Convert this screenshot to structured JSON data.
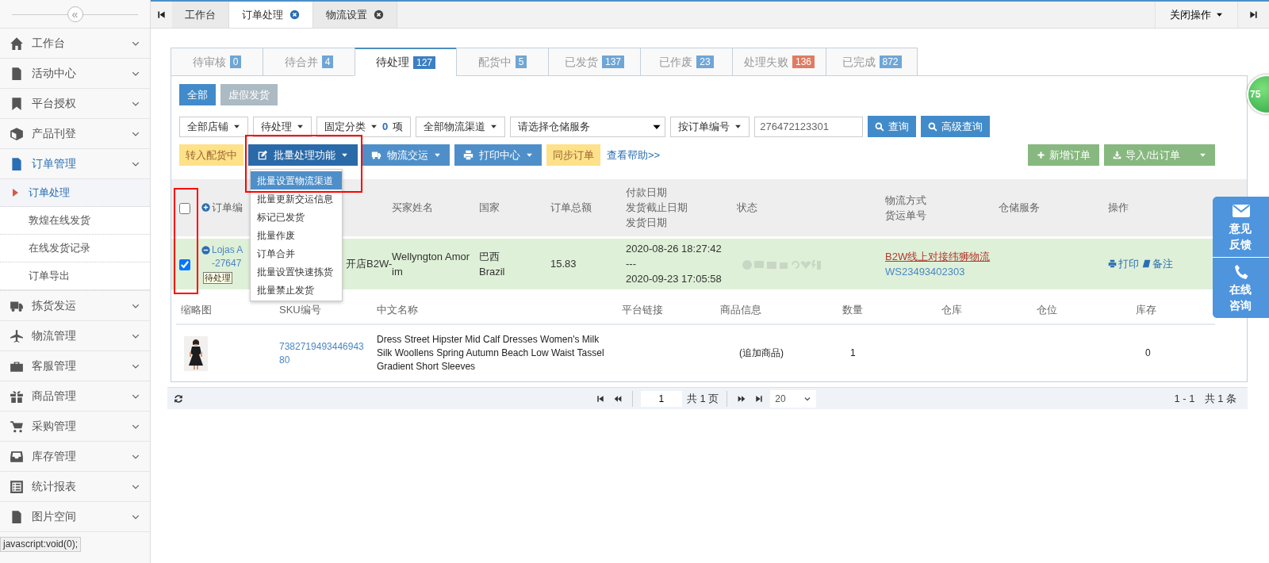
{
  "sidebar": {
    "collapse_glyph": "«",
    "items": [
      {
        "label": "工作台",
        "expanded": false
      },
      {
        "label": "活动中心",
        "expanded": false
      },
      {
        "label": "平台授权",
        "expanded": false
      },
      {
        "label": "产品刊登",
        "expanded": false
      },
      {
        "label": "订单管理",
        "expanded": true,
        "children": [
          {
            "label": "订单处理",
            "selected": true
          },
          {
            "label": "敦煌在线发货",
            "selected": false
          },
          {
            "label": "在线发货记录",
            "selected": false
          },
          {
            "label": "订单导出",
            "selected": false
          }
        ]
      },
      {
        "label": "拣货发运",
        "expanded": false
      },
      {
        "label": "物流管理",
        "expanded": false
      },
      {
        "label": "客服管理",
        "expanded": false
      },
      {
        "label": "商品管理",
        "expanded": false
      },
      {
        "label": "采购管理",
        "expanded": false
      },
      {
        "label": "库存管理",
        "expanded": false
      },
      {
        "label": "统计报表",
        "expanded": false
      },
      {
        "label": "图片空间",
        "expanded": false
      }
    ]
  },
  "page_tabs": [
    {
      "label": "工作台",
      "closable": false,
      "selected": false
    },
    {
      "label": "订单处理",
      "closable": true,
      "selected": true
    },
    {
      "label": "物流设置",
      "closable": true,
      "selected": false
    }
  ],
  "close_menu": {
    "label": "关闭操作"
  },
  "status_tabs": [
    {
      "label": "待审核",
      "count": "0",
      "color": "#6fa6d6",
      "selected": false
    },
    {
      "label": "待合并",
      "count": "4",
      "color": "#6fa6d6",
      "selected": false
    },
    {
      "label": "待处理",
      "count": "127",
      "color": "#3d7fc1",
      "selected": true
    },
    {
      "label": "配货中",
      "count": "5",
      "color": "#6fa6d6",
      "selected": false
    },
    {
      "label": "已发货",
      "count": "137",
      "color": "#6fa6d6",
      "selected": false
    },
    {
      "label": "已作废",
      "count": "23",
      "color": "#6fa6d6",
      "selected": false
    },
    {
      "label": "处理失败",
      "count": "136",
      "color": "#e07b62",
      "selected": false
    },
    {
      "label": "已完成",
      "count": "872",
      "color": "#6fa6d6",
      "selected": false
    }
  ],
  "view_filters": [
    {
      "label": "全部",
      "selected": true
    },
    {
      "label": "虚假发货",
      "selected": false
    }
  ],
  "filters": [
    {
      "kind": "dropdown",
      "label": "全部店铺"
    },
    {
      "kind": "dropdown",
      "label": "待处理"
    },
    {
      "kind": "counter",
      "label": "固定分类",
      "count": "0",
      "unit": "项"
    },
    {
      "kind": "dropdown",
      "label": "全部物流渠道"
    },
    {
      "kind": "select",
      "label": "请选择仓储服务"
    },
    {
      "kind": "dropdown",
      "label": "按订单编号"
    },
    {
      "kind": "input",
      "value": "276472123301"
    },
    {
      "kind": "button",
      "label": "查询"
    },
    {
      "kind": "button",
      "label": "高级查询"
    }
  ],
  "actions": [
    {
      "kind": "warning",
      "label": "转入配货中"
    },
    {
      "kind": "menu",
      "label": "批量处理功能",
      "expanded": true,
      "highlighted": true
    },
    {
      "kind": "menu",
      "label": "物流交运",
      "expanded": false,
      "highlighted": false
    },
    {
      "kind": "menu",
      "label": "打印中心",
      "expanded": false,
      "highlighted": false
    },
    {
      "kind": "warning",
      "label": "同步订单"
    },
    {
      "kind": "link",
      "label": "查看帮助>>"
    }
  ],
  "right_actions": [
    {
      "label": "新增订单",
      "caret": false
    },
    {
      "label": "导入/出订单",
      "caret": true
    }
  ],
  "batch_menu": [
    {
      "label": "批量设置物流渠道",
      "selected": true
    },
    {
      "label": "批量更新交运信息",
      "selected": false
    },
    {
      "label": "标记已发货",
      "selected": false
    },
    {
      "label": "批量作废",
      "selected": false
    },
    {
      "label": "订单合并",
      "selected": false
    },
    {
      "label": "批量设置快速拣货",
      "selected": false
    },
    {
      "label": "批量禁止发货",
      "selected": false
    }
  ],
  "orders_table": {
    "header": {
      "select_all_checked": false,
      "select_column_highlighted": true,
      "order_number": "订单编",
      "buyer": "买家姓名",
      "country": "国家",
      "total": "订单总额",
      "dates": [
        "付款日期",
        "发货截止日期",
        "发货日期"
      ],
      "status": "状态",
      "shipping": [
        "物流方式",
        "货运单号"
      ],
      "storage": "仓储服务",
      "actions": "操作"
    },
    "rows": [
      {
        "checked": true,
        "order_lines": [
          "Lojas A",
          "-27647"
        ],
        "tag": "待处理",
        "store": "开店B2W-",
        "buyer": "Wellyngton Amorim",
        "country": [
          "巴西",
          "Brazil"
        ],
        "total": "15.83",
        "dates": [
          "2020-08-26 18:27:42",
          "---",
          "2020-09-23 17:05:58"
        ],
        "shipping_method": "B2W线上对接纬狮物流",
        "tracking": "WS23493402303",
        "actions": [
          "打印",
          "备注"
        ],
        "items_header": [
          "缩略图",
          "SKU编号",
          "中文名称",
          "平台链接",
          "商品信息",
          "数量",
          "仓库",
          "仓位",
          "库存"
        ],
        "items": [
          {
            "sku": "738271949344694380",
            "name": "Dress Street Hipster Mid Calf Dresses Women's Milk Silk Woollens Spring Autumn Beach Low Waist Tassel Gradient Short Sleeves",
            "info": "(追加商品)",
            "quantity": "1",
            "stock": "0"
          }
        ]
      }
    ]
  },
  "pagination": {
    "page": "1",
    "total_pages": "共 1 页",
    "page_size": "20",
    "range": "1 - 1",
    "total": "共 1 条"
  },
  "float_ball": "75",
  "feedback": [
    "意见反馈",
    "在线咨询"
  ],
  "status_url": "javascript:void(0);"
}
